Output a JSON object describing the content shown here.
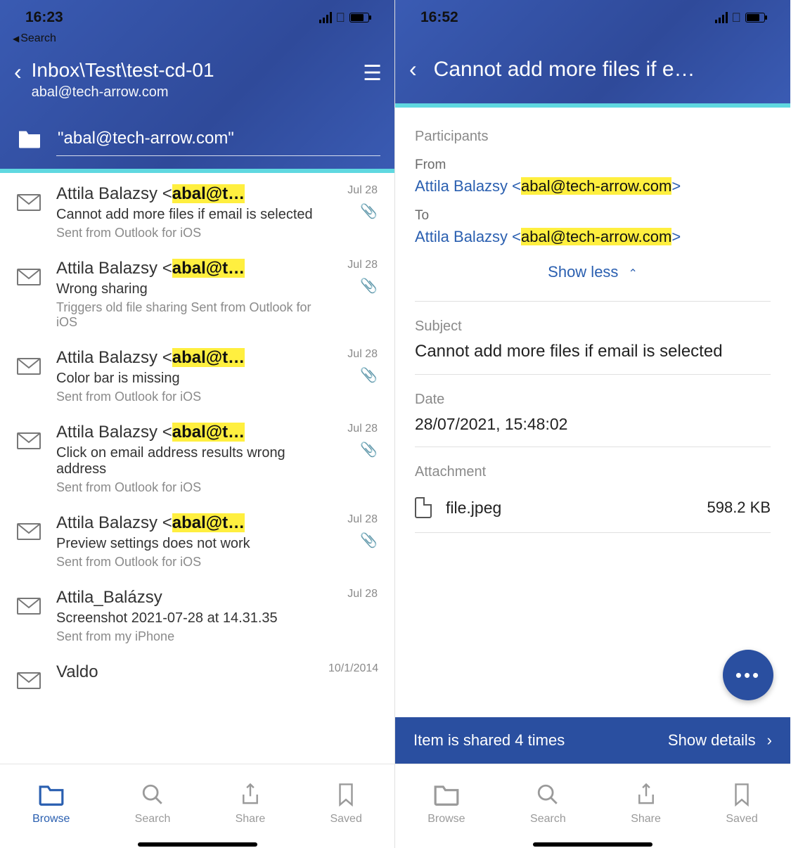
{
  "left": {
    "status_time": "16:23",
    "back_search": "Search",
    "title": "Inbox\\Test\\test-cd-01",
    "subtitle": "abal@tech-arrow.com",
    "search_value": "\"abal@tech-arrow.com\"",
    "items": [
      {
        "from_prefix": "Attila Balazsy <",
        "from_hl": "abal@t…",
        "subject": "Cannot add more files if email is selected",
        "preview": "Sent from Outlook for iOS",
        "date": "Jul 28",
        "attach": true
      },
      {
        "from_prefix": "Attila Balazsy <",
        "from_hl": "abal@t…",
        "subject": "Wrong sharing",
        "preview": "Triggers old file sharing Sent from Outlook for iOS",
        "date": "Jul 28",
        "attach": true
      },
      {
        "from_prefix": "Attila Balazsy <",
        "from_hl": "abal@t…",
        "subject": "Color bar is missing",
        "preview": "Sent from Outlook for iOS",
        "date": "Jul 28",
        "attach": true
      },
      {
        "from_prefix": "Attila Balazsy <",
        "from_hl": "abal@t…",
        "subject": "Click on email address results wrong address",
        "preview": "Sent from Outlook for iOS",
        "date": "Jul 28",
        "attach": true
      },
      {
        "from_prefix": "Attila Balazsy <",
        "from_hl": "abal@t…",
        "subject": "Preview settings does not work",
        "preview": "Sent from Outlook for iOS",
        "date": "Jul 28",
        "attach": true
      },
      {
        "from_prefix": "Attila_Balázsy",
        "from_hl": "",
        "subject": "Screenshot 2021-07-28 at 14.31.35",
        "preview": "Sent from my iPhone",
        "date": "Jul 28",
        "attach": false
      },
      {
        "from_prefix": "Valdo",
        "from_hl": "",
        "subject": "",
        "preview": "",
        "date": "10/1/2014",
        "attach": false
      }
    ]
  },
  "right": {
    "status_time": "16:52",
    "title": "Cannot add more files if e…",
    "participants_label": "Participants",
    "from_label": "From",
    "from_name": "Attila Balazsy <",
    "from_email": "abal@tech-arrow.com",
    "from_suffix": ">",
    "to_label": "To",
    "to_name": "Attila Balazsy <",
    "to_email": "abal@tech-arrow.com",
    "to_suffix": ">",
    "show_less": "Show less",
    "subject_label": "Subject",
    "subject_value": "Cannot add more files if email is selected",
    "date_label": "Date",
    "date_value": "28/07/2021, 15:48:02",
    "attach_label": "Attachment",
    "attach_name": "file.jpeg",
    "attach_size": "598.2 KB",
    "share_text": "Item is shared 4 times",
    "share_link": "Show details"
  },
  "tabs": {
    "browse": "Browse",
    "search": "Search",
    "share": "Share",
    "saved": "Saved"
  }
}
